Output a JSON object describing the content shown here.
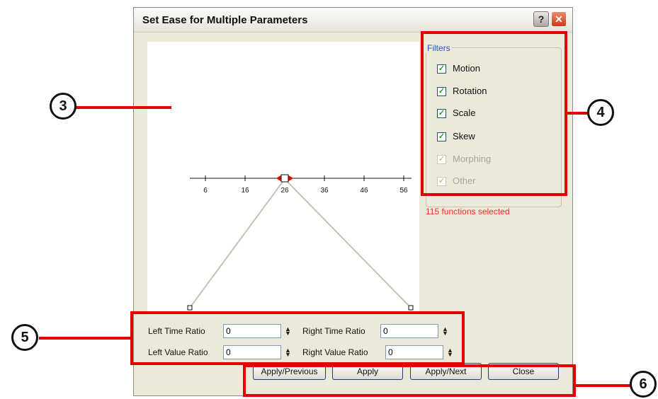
{
  "dialog": {
    "title": "Set Ease for Multiple Parameters",
    "help_glyph": "?",
    "close_glyph": "✕"
  },
  "graph": {
    "ticks": [
      "6",
      "16",
      "26",
      "36",
      "46",
      "56"
    ]
  },
  "filters": {
    "legend": "Filters",
    "items": [
      {
        "label": "Motion",
        "checked": true,
        "enabled": true
      },
      {
        "label": "Rotation",
        "checked": true,
        "enabled": true
      },
      {
        "label": "Scale",
        "checked": true,
        "enabled": true
      },
      {
        "label": "Skew",
        "checked": true,
        "enabled": true
      },
      {
        "label": "Morphing",
        "checked": true,
        "enabled": false
      },
      {
        "label": "Other",
        "checked": true,
        "enabled": false
      }
    ],
    "count_text": "115 functions selected"
  },
  "fields": {
    "left_time_label": "Left Time Ratio",
    "left_time_value": "0",
    "right_time_label": "Right Time Ratio",
    "right_time_value": "0",
    "left_value_label": "Left Value Ratio",
    "left_value_value": "0",
    "right_value_label": "Right Value Ratio",
    "right_value_value": "0"
  },
  "buttons": {
    "apply_previous": "Apply/Previous",
    "apply": "Apply",
    "apply_next": "Apply/Next",
    "close": "Close"
  },
  "callouts": {
    "c3": "3",
    "c4": "4",
    "c5": "5",
    "c6": "6"
  },
  "colors": {
    "highlight": "#e40000",
    "accent": "#2153d8",
    "count_text": "#ff2a2a"
  }
}
